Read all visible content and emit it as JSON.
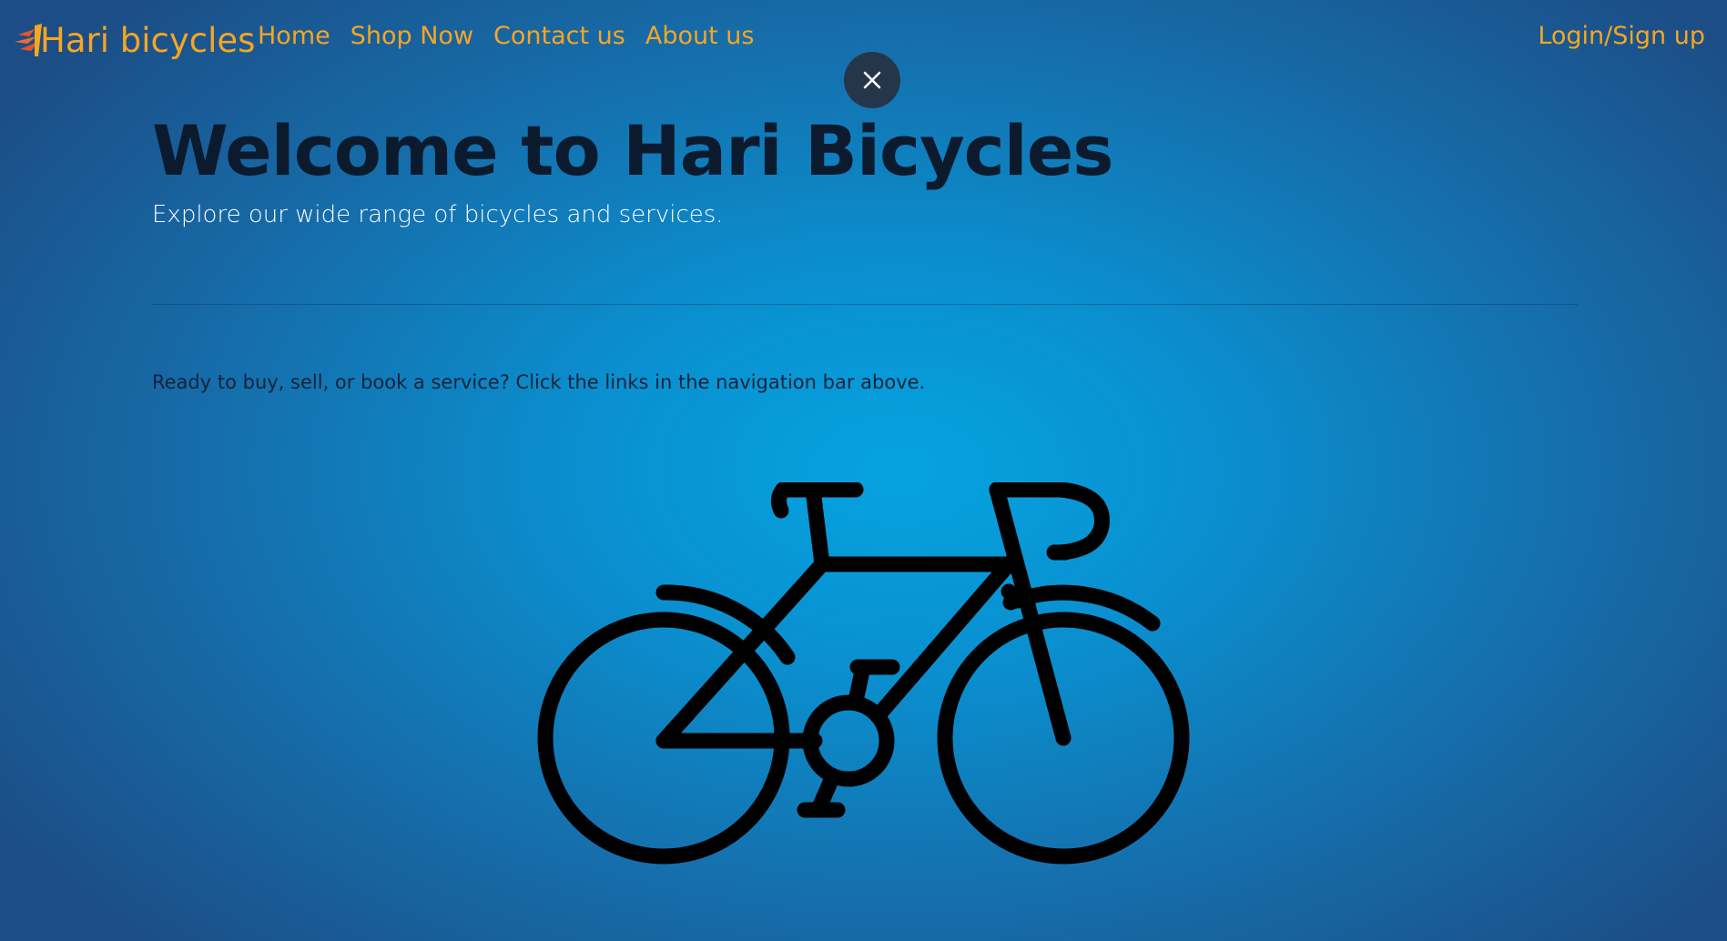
{
  "nav": {
    "brand": "Hari bicycles",
    "links": [
      "Home",
      "Shop Now",
      "Contact us",
      "About us"
    ],
    "login": "Login/Sign up"
  },
  "overlay": {
    "close_icon": "close-icon"
  },
  "hero": {
    "title": "Welcome to Hari Bicycles",
    "subtitle": "Explore our wide range of bicycles and services."
  },
  "cta": {
    "text": "Ready to buy, sell, or book a service? Click the links in the navigation bar above."
  },
  "illustration": {
    "icon": "bicycle-icon"
  },
  "colors": {
    "nav_text": "#f5a623",
    "title": "#0c1a2e",
    "subtitle": "#ffffff",
    "close_button": "#26364a"
  }
}
